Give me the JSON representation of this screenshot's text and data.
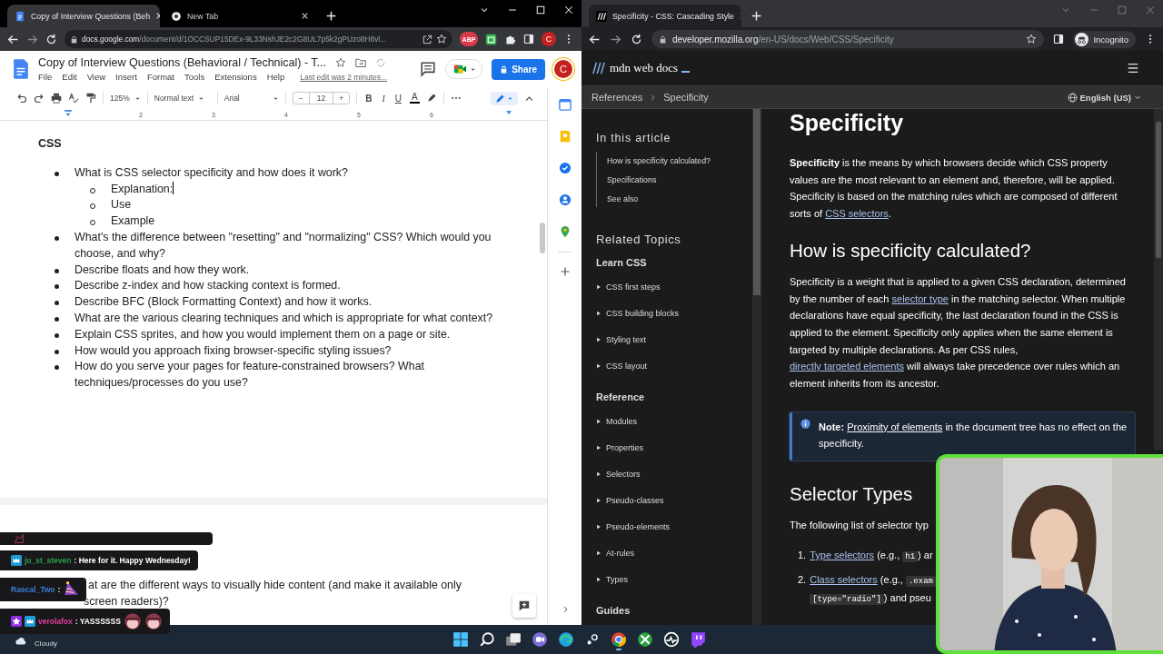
{
  "left_window": {
    "tabs": [
      {
        "kind": "docs",
        "title": "Copy of Interview Questions (Beh",
        "selected": true
      },
      {
        "kind": "newtab",
        "title": "New Tab",
        "selected": false
      }
    ],
    "url": {
      "host": "docs.google.com",
      "path": "/document/d/1OCCSUP15DEx-9L33NshJE2c2G8UL7p5k2gPUzo8H8vl..."
    },
    "extension_badge": "ABP",
    "profile": "C"
  },
  "docs": {
    "title": "Copy of Interview Questions (Behavioral / Technical) - T...",
    "menu": [
      "File",
      "Edit",
      "View",
      "Insert",
      "Format",
      "Tools",
      "Extensions",
      "Help"
    ],
    "last_edit": "Last edit was 2 minutes...",
    "share": "Share",
    "avatar": "C",
    "toolbar": {
      "zoom": "125%",
      "style": "Normal text",
      "font": "Arial",
      "minus": "−",
      "size": "12",
      "plus": "+",
      "bold": "B",
      "italic": "I",
      "underline": "U",
      "text_color": "A"
    },
    "ruler": [
      "2",
      "3",
      "4",
      "5",
      "6"
    ],
    "heading": "CSS",
    "questions": [
      {
        "text": "What is CSS selector specificity and how does it work?",
        "children": [
          {
            "text": "Explanation:",
            "cursor": true
          },
          {
            "text": "Use",
            "cursor": false
          },
          {
            "text": "Example",
            "cursor": false
          }
        ]
      },
      {
        "text": "What's the difference between \"resetting\" and \"normalizing\" CSS? Which would you choose, and why?"
      },
      {
        "text": "Describe floats and how they work."
      },
      {
        "text": "Describe z-index and how stacking context is formed."
      },
      {
        "text": "Describe BFC (Block Formatting Context) and how it works."
      },
      {
        "text": "What are the various clearing techniques and which is appropriate for what context?"
      },
      {
        "text": "Explain CSS sprites, and how you would implement them on a page or site."
      },
      {
        "text": "How would you approach fixing browser-specific styling issues?"
      },
      {
        "text": "How do you serve your pages for feature-constrained browsers? What techniques/processes do you use?"
      }
    ],
    "next_page_lines": [
      "at are the different ways to visually hide content (and make it available only",
      "screen readers)?"
    ]
  },
  "right_window": {
    "tabs": [
      {
        "kind": "mdn",
        "title": "Specificity - CSS: Cascading Style",
        "selected": true
      }
    ],
    "url": {
      "host": "developer.mozilla.org",
      "path": "/en-US/docs/Web/CSS/Specificity"
    },
    "incognito": "Incognito"
  },
  "mdn": {
    "logo": "mdn web docs",
    "breadcrumbs": [
      "References",
      "Specificity"
    ],
    "language": "English (US)",
    "toc_title": "In this article",
    "toc": [
      "How is specificity calculated?",
      "Specifications",
      "See also"
    ],
    "related_title": "Related Topics",
    "groups": [
      {
        "title": "Learn CSS",
        "items": [
          "CSS first steps",
          "CSS building blocks",
          "Styling text",
          "CSS layout"
        ]
      },
      {
        "title": "Reference",
        "items": [
          "Modules",
          "Properties",
          "Selectors",
          "Pseudo-classes",
          "Pseudo-elements",
          "At-rules",
          "Types"
        ]
      },
      {
        "title": "Guides"
      }
    ],
    "title": "Specificity",
    "intro": [
      {
        "kind": "text",
        "text": "**Specificity** is the means by which browsers decide which CSS property values are the most relevant to an element and, therefore, will be applied. Specificity is based on the matching rules which are composed of different sorts of "
      },
      {
        "kind": "link",
        "text": "CSS selectors"
      },
      {
        "kind": "text",
        "text": "."
      }
    ],
    "h2": "How is specificity calculated?",
    "calc": [
      {
        "kind": "text",
        "text": "Specificity is a weight that is applied to a given CSS declaration, determined by the number of each "
      },
      {
        "kind": "link",
        "text": "selector type"
      },
      {
        "kind": "text",
        "text": " in the matching selector. When multiple declarations have equal specificity, the last declaration found in the CSS is applied to the element. Specificity only applies when the same element is targeted by multiple declarations. As per CSS rules, "
      },
      {
        "kind": "link",
        "text": "directly targeted elements"
      },
      {
        "kind": "text",
        "text": " will always take precedence over rules which an element inherits from its ancestor."
      }
    ],
    "note": [
      {
        "kind": "text",
        "text": "**Note:** "
      },
      {
        "kind": "link",
        "text": "Proximity of elements"
      },
      {
        "kind": "text",
        "text": " in the document tree has no effect on the specificity."
      }
    ],
    "h2b": "Selector Types",
    "list_intro": "The following list of selector typ",
    "list": [
      {
        "number": "1.",
        "runs": [
          {
            "kind": "link",
            "text": "Type selectors"
          },
          {
            "kind": "text",
            "text": " (e.g., "
          },
          {
            "kind": "code",
            "text": "h1"
          },
          {
            "kind": "text",
            "text": ") ar"
          }
        ]
      },
      {
        "number": "2.",
        "runs": [
          {
            "kind": "link",
            "text": "Class selectors"
          },
          {
            "kind": "text",
            "text": " (e.g., "
          },
          {
            "kind": "code",
            "text": ".exam"
          },
          {
            "kind": "break"
          },
          {
            "kind": "code",
            "text": "[type=\"radio\"]"
          },
          {
            "kind": "text",
            "text": ") and pseu"
          }
        ]
      }
    ]
  },
  "chat": [
    {
      "kind": "emote-only"
    },
    {
      "kind": "subscriber",
      "user": "ju_st_steven",
      "color": "#2f9e4a",
      "text": ": Here for it. Happy Wednesday!"
    },
    {
      "kind": "emote",
      "user": "Rascal_Two",
      "color": "#3a7fd8",
      "text": ":"
    },
    {
      "kind": "star-subscriber",
      "user": "verolafox",
      "color": "#e0409a",
      "text": ": YASSSSSS"
    }
  ],
  "taskbar": {
    "weather": "Cloudy",
    "apps": [
      {
        "kind": "start",
        "selected": false
      },
      {
        "kind": "search",
        "selected": false
      },
      {
        "kind": "taskview",
        "selected": false
      },
      {
        "kind": "chat",
        "selected": false
      },
      {
        "kind": "edge",
        "selected": false
      },
      {
        "kind": "steam",
        "selected": false
      },
      {
        "kind": "chrome",
        "selected": true
      },
      {
        "kind": "xbox",
        "selected": false
      },
      {
        "kind": "dev",
        "selected": false
      },
      {
        "kind": "twitch",
        "selected": false
      }
    ]
  }
}
